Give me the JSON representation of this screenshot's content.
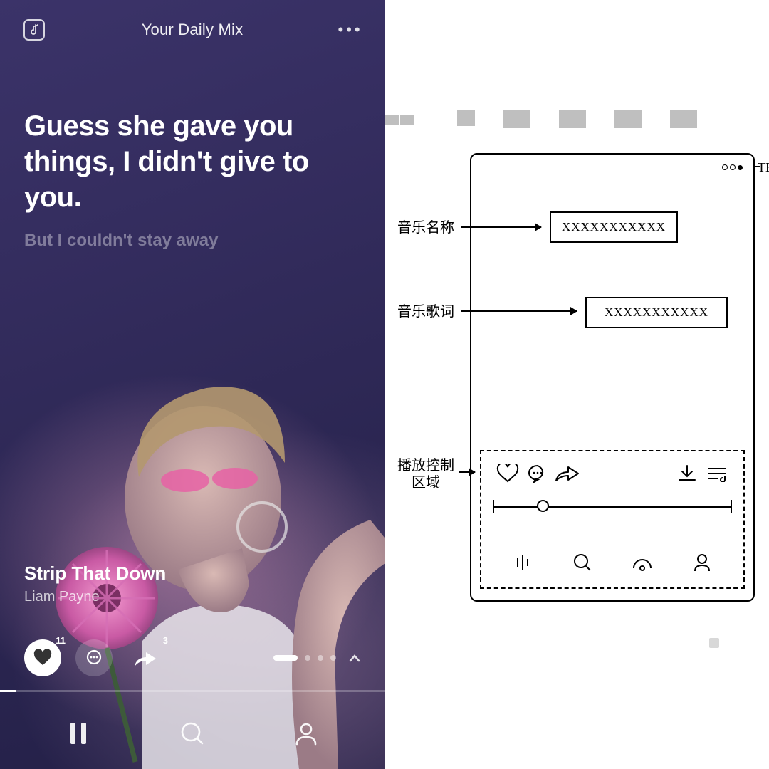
{
  "left": {
    "header": {
      "title": "Your Daily Mix"
    },
    "lyrics": {
      "current": "Guess she gave you things, I didn't give to you.",
      "next": "But I couldn't stay away"
    },
    "track": {
      "title": "Strip That Down",
      "artist": "Liam Payne"
    },
    "actions": {
      "like_count": "11",
      "share_count": "3"
    },
    "progress_percent": 4
  },
  "right": {
    "labels": {
      "menu_cut": "TE",
      "music_name": "音乐名称",
      "music_lyrics": "音乐歌词",
      "play_control": "播放控制\n区域"
    },
    "placeholders": {
      "name_box": "XXXXXXXXXXX",
      "lyrics_box": "XXXXXXXXXXX"
    }
  }
}
